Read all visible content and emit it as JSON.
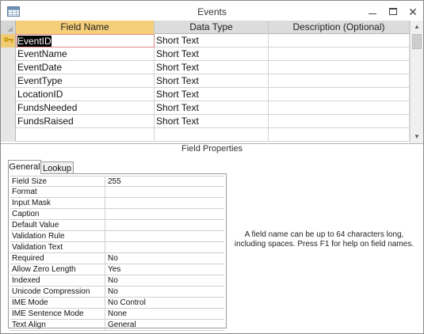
{
  "window": {
    "title": "Events",
    "icon": "table-icon",
    "controls": [
      "minimize-icon",
      "maximize-icon",
      "close-icon"
    ]
  },
  "grid": {
    "headers": [
      "Field Name",
      "Data Type",
      "Description (Optional)"
    ],
    "rows": [
      {
        "name": "EventID",
        "type": "Short Text",
        "description": "",
        "primary_key": true
      },
      {
        "name": "EventName",
        "type": "Short Text",
        "description": ""
      },
      {
        "name": "EventDate",
        "type": "Short Text",
        "description": ""
      },
      {
        "name": "EventType",
        "type": "Short Text",
        "description": ""
      },
      {
        "name": "LocationID",
        "type": "Short Text",
        "description": ""
      },
      {
        "name": "FundsNeeded",
        "type": "Short Text",
        "description": ""
      },
      {
        "name": "FundsRaised",
        "type": "Short Text",
        "description": ""
      },
      {
        "name": "",
        "type": "",
        "description": ""
      }
    ]
  },
  "field_properties": {
    "title": "Field Properties",
    "tabs": [
      "General",
      "Lookup"
    ],
    "active_tab": "General",
    "properties": [
      {
        "label": "Field Size",
        "value": "255"
      },
      {
        "label": "Format",
        "value": ""
      },
      {
        "label": "Input Mask",
        "value": ""
      },
      {
        "label": "Caption",
        "value": ""
      },
      {
        "label": "Default Value",
        "value": ""
      },
      {
        "label": "Validation Rule",
        "value": ""
      },
      {
        "label": "Validation Text",
        "value": ""
      },
      {
        "label": "Required",
        "value": "No"
      },
      {
        "label": "Allow Zero Length",
        "value": "Yes"
      },
      {
        "label": "Indexed",
        "value": "No"
      },
      {
        "label": "Unicode Compression",
        "value": "No"
      },
      {
        "label": "IME Mode",
        "value": "No Control"
      },
      {
        "label": "IME Sentence Mode",
        "value": "None"
      },
      {
        "label": "Text Align",
        "value": "General"
      }
    ],
    "help_text": "A field name can be up to 64 characters long, including spaces. Press F1 for help on field names."
  },
  "colors": {
    "active_header": "#f5cf7a",
    "active_row_selector": "#f2cc74",
    "key_icon": "#c99a12"
  }
}
